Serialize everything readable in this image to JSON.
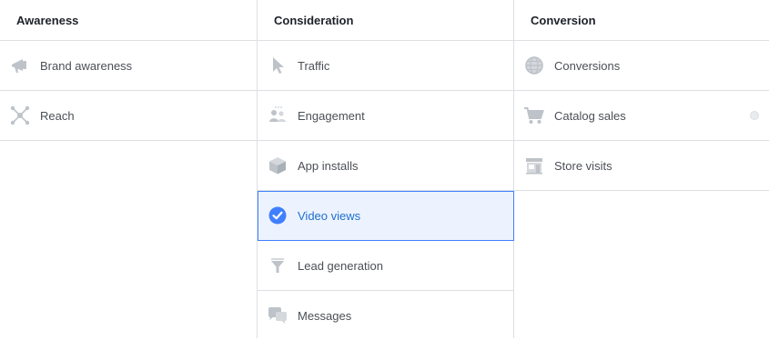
{
  "columns": [
    {
      "heading": "Awareness",
      "items": [
        {
          "label": "Brand awareness",
          "icon": "megaphone-icon"
        },
        {
          "label": "Reach",
          "icon": "reach-icon"
        }
      ]
    },
    {
      "heading": "Consideration",
      "items": [
        {
          "label": "Traffic",
          "icon": "cursor-icon"
        },
        {
          "label": "Engagement",
          "icon": "people-icon"
        },
        {
          "label": "App installs",
          "icon": "cube-icon"
        },
        {
          "label": "Video views",
          "icon": "check-circle-icon",
          "selected": true
        },
        {
          "label": "Lead generation",
          "icon": "funnel-icon"
        },
        {
          "label": "Messages",
          "icon": "chat-icon"
        }
      ]
    },
    {
      "heading": "Conversion",
      "items": [
        {
          "label": "Conversions",
          "icon": "globe-icon"
        },
        {
          "label": "Catalog sales",
          "icon": "cart-icon",
          "has_info": true
        },
        {
          "label": "Store visits",
          "icon": "store-icon"
        }
      ]
    }
  ],
  "colors": {
    "icon_gray": "#bec3c9",
    "selected_bg": "#ecf3fe",
    "selected_border": "#4080ff",
    "selected_text": "#1f6fd1",
    "divider": "#dddfe2"
  }
}
